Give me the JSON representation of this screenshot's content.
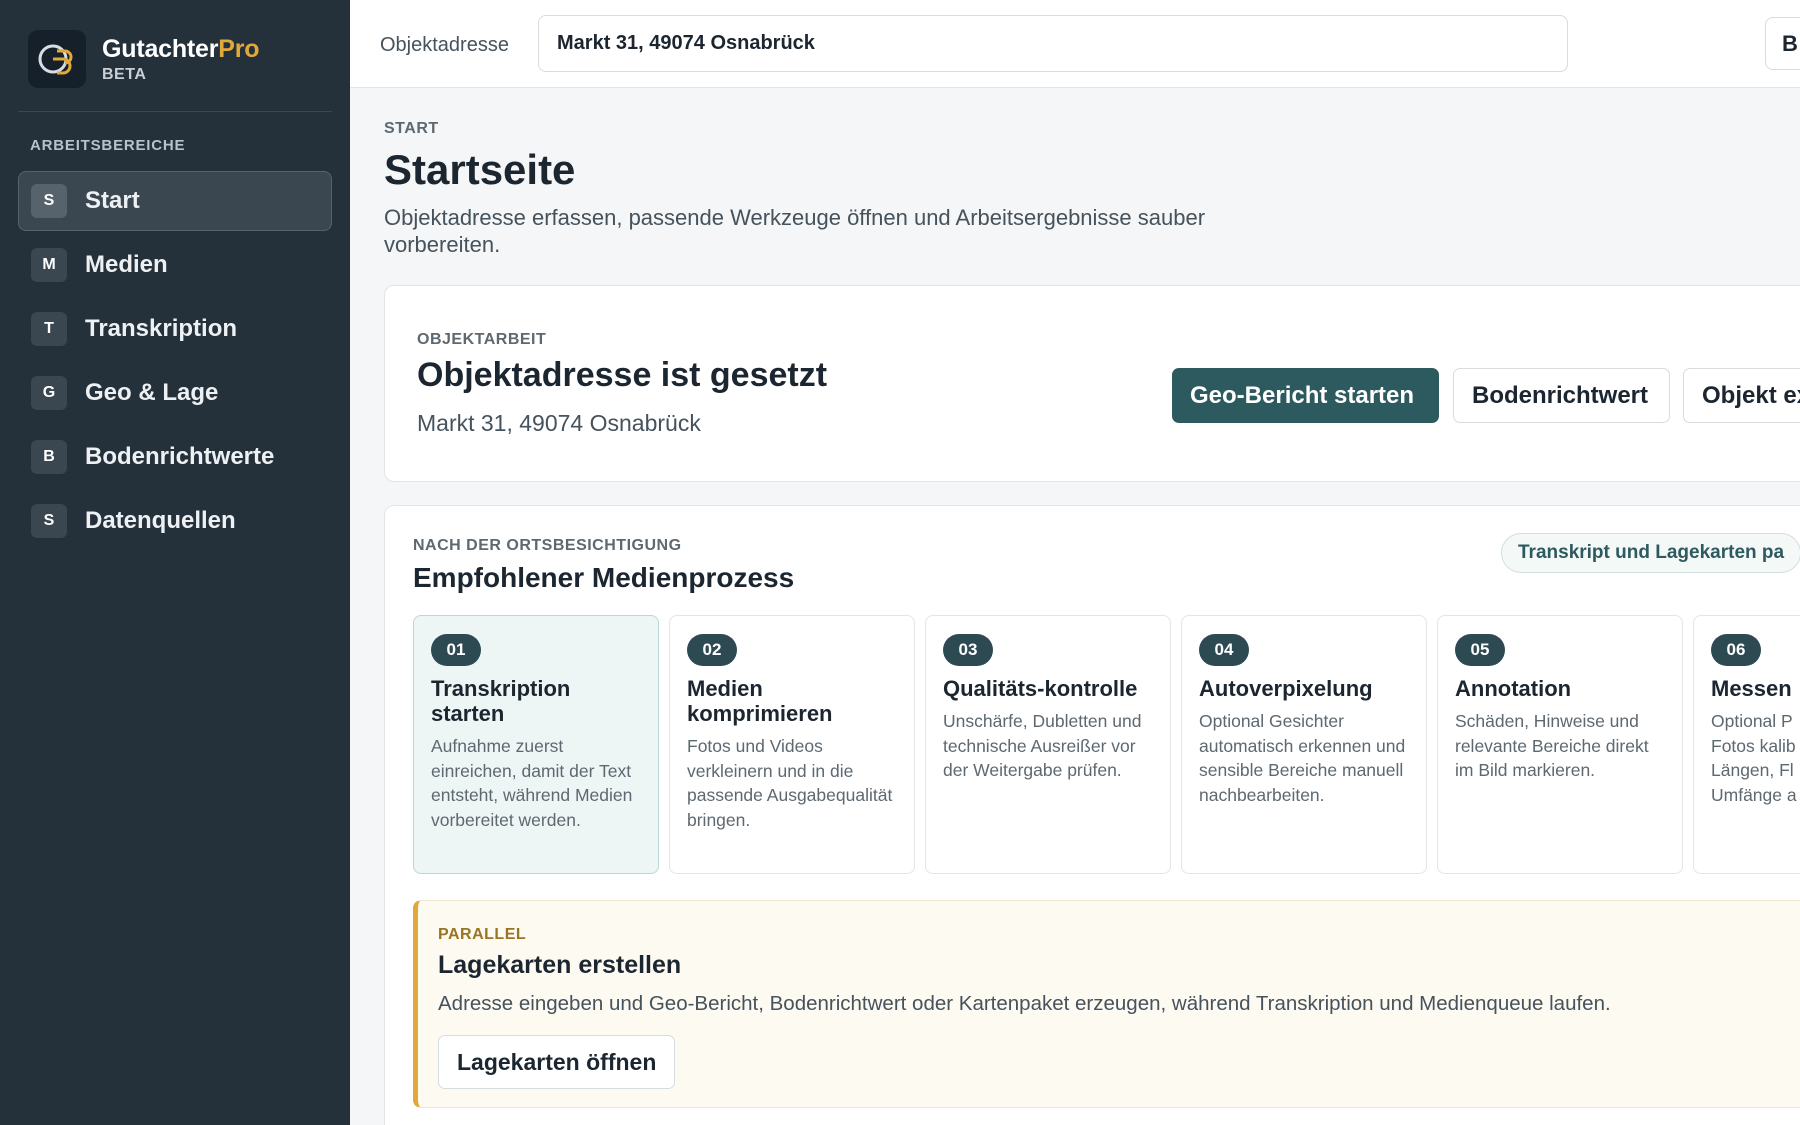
{
  "brand": {
    "name_main": "Gutachter",
    "name_accent": "Pro",
    "badge": "BETA",
    "logo_text": "GP"
  },
  "sidebar": {
    "section_label": "ARBEITSBEREICHE",
    "items": [
      {
        "letter": "S",
        "label": "Start",
        "active": true
      },
      {
        "letter": "M",
        "label": "Medien"
      },
      {
        "letter": "T",
        "label": "Transkription"
      },
      {
        "letter": "G",
        "label": "Geo & Lage"
      },
      {
        "letter": "B",
        "label": "Bodenrichtwerte"
      },
      {
        "letter": "S",
        "label": "Datenquellen"
      }
    ]
  },
  "topbar": {
    "address_label": "Objektadresse",
    "address_value": "Markt 31, 49074 Osnabrück",
    "button_label": "B"
  },
  "page": {
    "eyebrow": "START",
    "title": "Startseite",
    "subtitle": "Objektadresse erfassen, passende Werkzeuge öffnen und Arbeitsergebnisse sauber vorbereiten."
  },
  "object_card": {
    "eyebrow": "OBJEKTARBEIT",
    "title": "Objektadresse ist gesetzt",
    "address": "Markt 31, 49074 Osnabrück",
    "buttons": {
      "geo": "Geo-Bericht starten",
      "boden": "Bodenrichtwert",
      "objekt": "Objekt ex"
    }
  },
  "media_card": {
    "eyebrow": "NACH DER ORTSBESICHTIGUNG",
    "title": "Empfohlener Medienprozess",
    "pill": "Transkript und Lagekarten pa",
    "steps": [
      {
        "num": "01",
        "title": "Transkription starten",
        "desc": "Aufnahme zuerst einreichen, damit der Text entsteht, während Medien vorbereitet werden."
      },
      {
        "num": "02",
        "title": "Medien komprimieren",
        "desc": "Fotos und Videos verkleinern und in die passende Ausgabequalität bringen."
      },
      {
        "num": "03",
        "title": "Qualitäts-kontrolle",
        "desc": "Unschärfe, Dubletten und technische Ausreißer vor der Weitergabe prüfen."
      },
      {
        "num": "04",
        "title": "Autoverpixelung",
        "desc": "Optional Gesichter automatisch erkennen und sensible Bereiche manuell nachbearbeiten."
      },
      {
        "num": "05",
        "title": "Annotation",
        "desc": "Schäden, Hinweise und relevante Bereiche direkt im Bild markieren."
      },
      {
        "num": "06",
        "title": "Messen",
        "desc": "Optional P Fotos kalib Längen, Fl Umfänge a"
      }
    ],
    "parallel": {
      "eyebrow": "PARALLEL",
      "title": "Lagekarten erstellen",
      "desc": "Adresse eingeben und Geo-Bericht, Bodenrichtwert oder Kartenpaket erzeugen, während Transkription und Medienqueue laufen.",
      "button": "Lagekarten öffnen"
    }
  }
}
